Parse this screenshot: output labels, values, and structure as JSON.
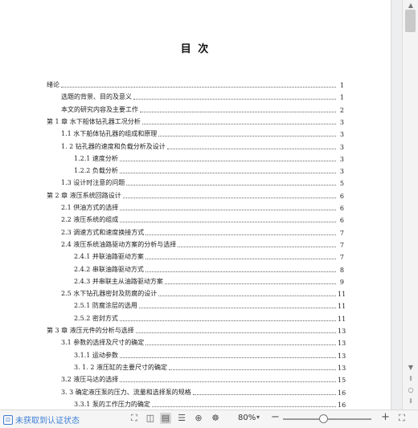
{
  "document": {
    "title": "目  次",
    "toc": [
      {
        "label": "绪论",
        "page": "1",
        "level": 0
      },
      {
        "label": "选题的背景、目的及意义",
        "page": "1",
        "level": 1
      },
      {
        "label": "本文的研究内容及主要工作",
        "page": "2",
        "level": 1
      },
      {
        "label": "第 1 章  水下船体钻孔器工况分析",
        "page": "3",
        "level": 0
      },
      {
        "label": "1.1 水下船体钻孔器的组成和原理",
        "page": "3",
        "level": 1
      },
      {
        "label": "1. 2 钻孔器的速度和负载分析及设计",
        "page": "3",
        "level": 1
      },
      {
        "label": "1.2.1 速度分析",
        "page": "3",
        "level": 2
      },
      {
        "label": "1.2.2 负载分析",
        "page": "3",
        "level": 2
      },
      {
        "label": "1.3 设计时注意的问题",
        "page": "5",
        "level": 1
      },
      {
        "label": "第 2 章   液压系统回路设计",
        "page": "6",
        "level": 0
      },
      {
        "label": "2.1 供油方式的选择",
        "page": "6",
        "level": 1
      },
      {
        "label": "2.2 液压系统的组成",
        "page": "6",
        "level": 1
      },
      {
        "label": "2.3 调速方式和速度换接方式",
        "page": "7",
        "level": 1
      },
      {
        "label": "2.4 液压系统油路驱动方案的分析与选择",
        "page": "7",
        "level": 1
      },
      {
        "label": "2.4.1 并联油路驱动方案",
        "page": "7",
        "level": 2
      },
      {
        "label": "2.4.2 串联油路驱动方式",
        "page": "8",
        "level": 2
      },
      {
        "label": "2.4.3 并串联主从油路驱动方案",
        "page": "9",
        "level": 2
      },
      {
        "label": "2.5 水下钻孔器密封及防腐的设计",
        "page": "11",
        "level": 1
      },
      {
        "label": "2.5.1 防腐涂层的选用",
        "page": "11",
        "level": 2
      },
      {
        "label": "2.5.2 密封方式",
        "page": "11",
        "level": 2
      },
      {
        "label": "第 3 章   液压元件的分析与选择",
        "page": "13",
        "level": 0
      },
      {
        "label": "3.1 参数的选择及尺寸的确定",
        "page": "13",
        "level": 1
      },
      {
        "label": "3.1.1 运动参数",
        "page": "13",
        "level": 2
      },
      {
        "label": "3. 1. 2 液压缸的主要尺寸的确定",
        "page": "13",
        "level": 2
      },
      {
        "label": "3.2 液压马达的选择",
        "page": "15",
        "level": 1
      },
      {
        "label": "3. 3 确定液压泵的压力、流量和选择泵的规格",
        "page": "16",
        "level": 1
      },
      {
        "label": "3.3.1 泵的工作压力的确定",
        "page": "16",
        "level": 2
      }
    ]
  },
  "statusbar": {
    "auth_status": "未获取到认证状态",
    "zoom": "80%",
    "zoom_value": 0.45,
    "minus": "−",
    "plus": "+"
  },
  "icons": [
    "document-status-icon",
    "fit-width-icon",
    "read-mode-icon",
    "page-view-icon",
    "outline-view-icon",
    "web-view-icon",
    "eye-protect-icon",
    "zoom-out-icon",
    "zoom-in-icon",
    "fullscreen-icon"
  ],
  "colors": {
    "accent": "#3d7fd6"
  }
}
